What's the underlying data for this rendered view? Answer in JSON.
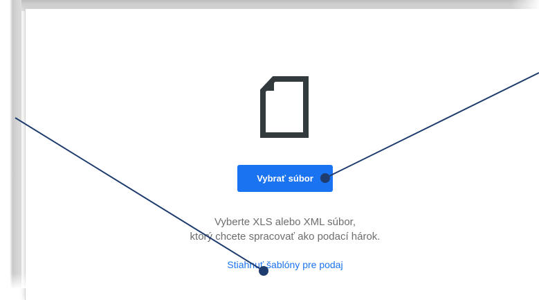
{
  "upload": {
    "icon": "file-icon",
    "choose_button_label": "Vybrať súbor",
    "description_line1": "Vyberte XLS alebo XML súbor,",
    "description_line2": "ktorý chcete spracovať ako podací hárok.",
    "template_link_label": "Stiahnuť šablóny pre podaj"
  },
  "colors": {
    "accent": "#1a73f0",
    "annotation_line": "#1f3c6e",
    "icon": "#333a3e"
  }
}
